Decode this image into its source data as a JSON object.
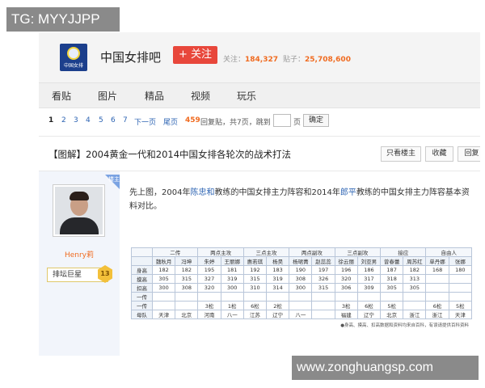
{
  "watermarks": {
    "top_left": "TG: MYYJJPP",
    "bottom_right": "www.zonghuangsp.com"
  },
  "forum": {
    "logo_text": "中国女排",
    "name": "中国女排吧",
    "follow_label": "+ 关注",
    "followers_label": "关注：",
    "followers_count": "184,327",
    "posts_label": "贴子：",
    "posts_count": "25,708,600"
  },
  "nav": {
    "items": [
      "看贴",
      "图片",
      "精品",
      "视频",
      "玩乐"
    ]
  },
  "pager": {
    "pages": [
      "1",
      "2",
      "3",
      "4",
      "5",
      "6",
      "7"
    ],
    "next_label": "下一页",
    "last_label": "尾页",
    "reply_count": "459",
    "reply_text": "回复贴，共7页，跳到",
    "page_unit": "页",
    "confirm_label": "确定"
  },
  "post": {
    "title": "【图解】2004黄金一代和2014中国女排各轮次的战术打法",
    "actions": [
      "只看楼主",
      "收藏",
      "回复"
    ],
    "badge": "楼主",
    "author": {
      "name": "Henry莉",
      "rank": "排坛巨星",
      "level": "13"
    },
    "text_a": "先上图，2004年",
    "coach_1": "陈忠和",
    "text_b": "教练的中国女排主力阵容和2014年",
    "coach_2": "郎平",
    "text_c": "教练的中国女排主力阵容基本资料对比。"
  },
  "table": {
    "groups": [
      "二传",
      "两点主攻",
      "三点主攻",
      "两点副攻",
      "三点副攻",
      "接应",
      "自由人"
    ],
    "names": [
      "魏秋月",
      "冯坤",
      "朱婷",
      "王丽娜",
      "惠若琪",
      "杨昊",
      "杨珺菁",
      "赵蕊蕊",
      "徐云丽",
      "刘亚男",
      "曾春蕾",
      "周苏红",
      "单丹娜",
      "张娜"
    ],
    "rows": [
      {
        "label": "身高",
        "cells": [
          "182",
          "182",
          "195",
          "181",
          "192",
          "183",
          "190",
          "197",
          "196",
          "186",
          "187",
          "182",
          "168",
          "180"
        ]
      },
      {
        "label": "摸高",
        "cells": [
          "305",
          "315",
          "327",
          "319",
          "315",
          "319",
          "308",
          "326",
          "320",
          "317",
          "318",
          "313",
          "",
          ""
        ]
      },
      {
        "label": "扣高",
        "cells": [
          "300",
          "308",
          "320",
          "300",
          "310",
          "314",
          "300",
          "315",
          "306",
          "309",
          "305",
          "305",
          "",
          ""
        ]
      },
      {
        "label": "一传",
        "cells": [
          "",
          "",
          "",
          "",
          "",
          "",
          "",
          "",
          "",
          "",
          "",
          "",
          "",
          ""
        ]
      },
      {
        "label": "一传",
        "cells": [
          "",
          "",
          "3松",
          "1松",
          "6松",
          "2松",
          "",
          "",
          "3松",
          "6松",
          "5松",
          "",
          "6松",
          "5松"
        ]
      },
      {
        "label": "母队",
        "cells": [
          "天津",
          "北京",
          "河南",
          "八一",
          "江苏",
          "辽宁",
          "八一",
          "",
          "福建",
          "辽宁",
          "北京",
          "浙江",
          "浙江",
          "天津"
        ]
      }
    ],
    "note": "●身高、摸高、扣高数据和资料均来自百科，有误请提供百科资料"
  }
}
